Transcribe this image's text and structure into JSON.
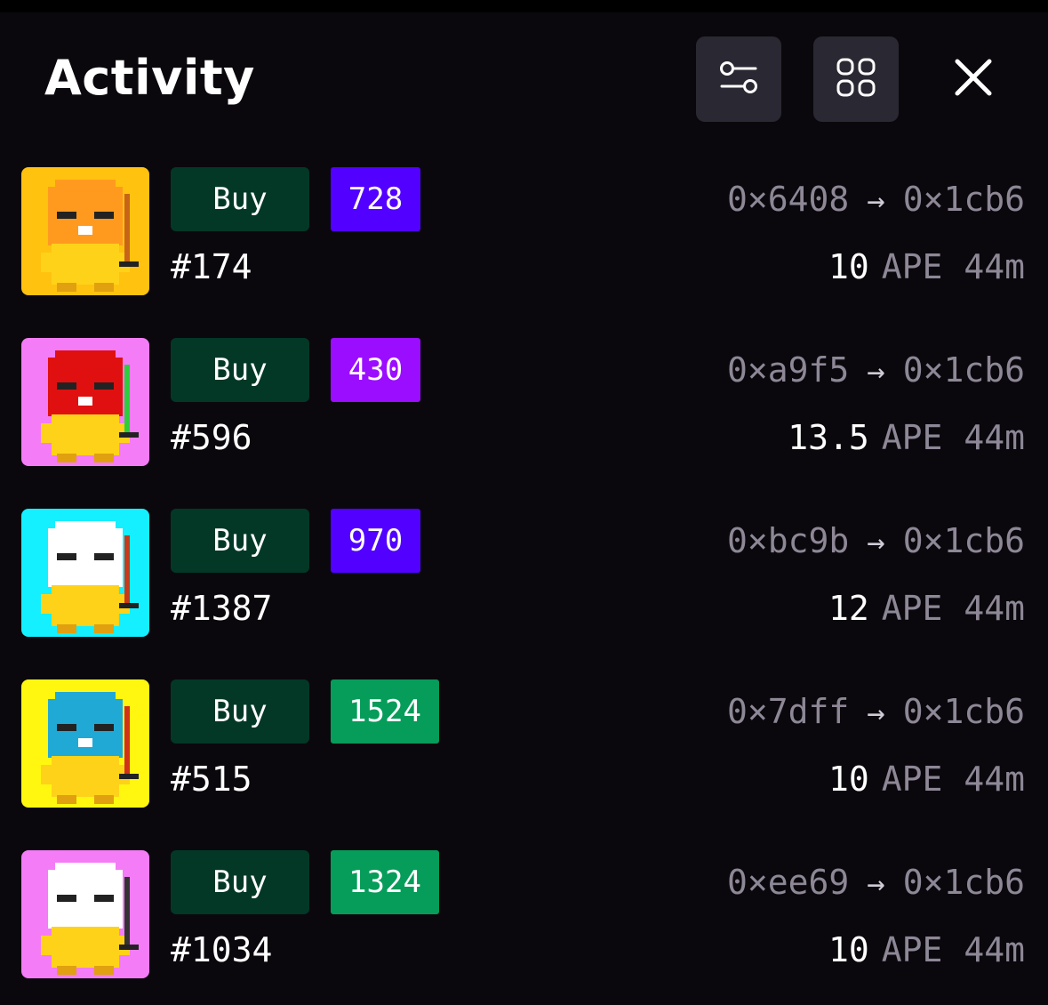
{
  "header": {
    "title": "Activity",
    "filter_icon": "sliders-icon",
    "grid_icon": "grid-icon",
    "close_icon": "close-icon"
  },
  "colors": {
    "background": "#0b080d",
    "buy_badge": "#033826",
    "rank_purple": "#5200ff",
    "rank_violet": "#9b0dff",
    "rank_green": "#069c5a",
    "muted_text": "#8d8796"
  },
  "activity": [
    {
      "type": "Buy",
      "rank": "728",
      "rank_color": "#5200ff",
      "token": "#174",
      "from": "0×6408",
      "arrow": "→",
      "to": "0×1cb6",
      "price": "10",
      "currency": "APE",
      "age": "44m",
      "thumb_bg": "#ffc20f"
    },
    {
      "type": "Buy",
      "rank": "430",
      "rank_color": "#9b0dff",
      "token": "#596",
      "from": "0×a9f5",
      "arrow": "→",
      "to": "0×1cb6",
      "price": "13.5",
      "currency": "APE",
      "age": "44m",
      "thumb_bg": "#f47cf6"
    },
    {
      "type": "Buy",
      "rank": "970",
      "rank_color": "#5200ff",
      "token": "#1387",
      "from": "0×bc9b",
      "arrow": "→",
      "to": "0×1cb6",
      "price": "12",
      "currency": "APE",
      "age": "44m",
      "thumb_bg": "#14f0ff"
    },
    {
      "type": "Buy",
      "rank": "1524",
      "rank_color": "#069c5a",
      "token": "#515",
      "from": "0×7dff",
      "arrow": "→",
      "to": "0×1cb6",
      "price": "10",
      "currency": "APE",
      "age": "44m",
      "thumb_bg": "#fff70f"
    },
    {
      "type": "Buy",
      "rank": "1324",
      "rank_color": "#069c5a",
      "token": "#1034",
      "from": "0×ee69",
      "arrow": "→",
      "to": "0×1cb6",
      "price": "10",
      "currency": "APE",
      "age": "44m",
      "thumb_bg": "#f47cf6"
    }
  ]
}
